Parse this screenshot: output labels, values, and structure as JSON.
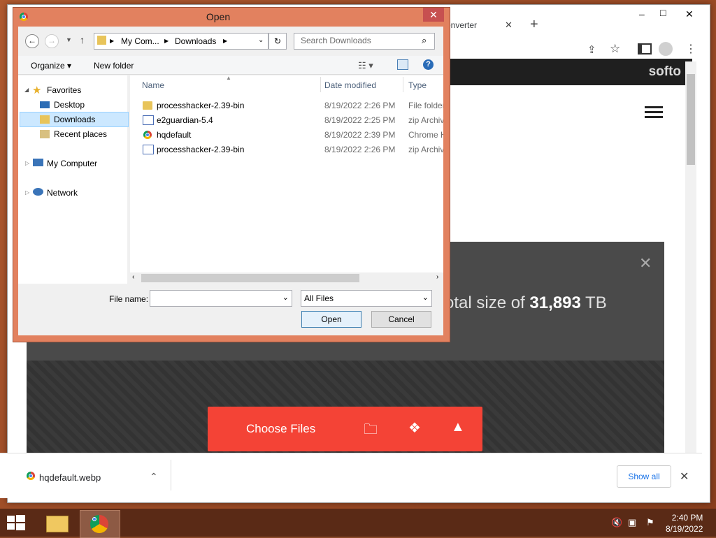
{
  "browser": {
    "tab_title": "onverter",
    "new_tab": "+",
    "window_controls": [
      "–",
      "□",
      "✕"
    ],
    "site_logo": "softo",
    "overlay_text_pre": "otal size of ",
    "overlay_text_value": "31,893",
    "overlay_text_unit": " TB",
    "choose_files": "Choose Files"
  },
  "downloads": {
    "file_name": "hqdefault.webp",
    "show_all": "Show all"
  },
  "dialog": {
    "title": "Open",
    "breadcrumb": [
      "My Com...",
      "Downloads"
    ],
    "search_placeholder": "Search Downloads",
    "organize": "Organize ▾",
    "new_folder": "New folder",
    "nav": {
      "favorites": "Favorites",
      "desktop": "Desktop",
      "downloads": "Downloads",
      "recent": "Recent places",
      "computer": "My Computer",
      "network": "Network"
    },
    "columns": [
      "Name",
      "Date modified",
      "Type"
    ],
    "files": [
      {
        "name": "processhacker-2.39-bin",
        "date": "8/19/2022 2:26 PM",
        "type": "File folder",
        "icon": "folder-icon"
      },
      {
        "name": "e2guardian-5.4",
        "date": "8/19/2022 2:25 PM",
        "type": "zip Archive",
        "icon": "zip-icon"
      },
      {
        "name": "hqdefault",
        "date": "8/19/2022 2:39 PM",
        "type": "Chrome H",
        "icon": "chrome-icon"
      },
      {
        "name": "processhacker-2.39-bin",
        "date": "8/19/2022 2:26 PM",
        "type": "zip Archive",
        "icon": "zip-icon"
      }
    ],
    "file_name_label": "File name:",
    "file_name_value": "",
    "filter": "All Files",
    "open": "Open",
    "cancel": "Cancel"
  },
  "taskbar": {
    "time": "2:40 PM",
    "date": "8/19/2022"
  }
}
